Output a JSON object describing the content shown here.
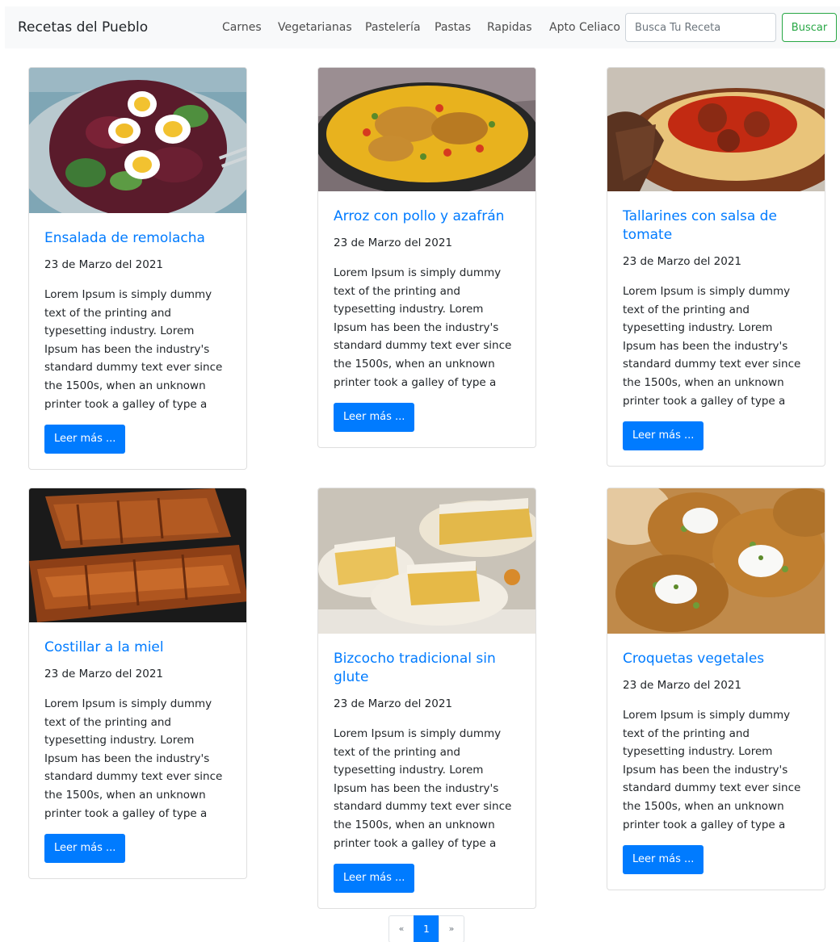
{
  "navbar": {
    "brand": "Recetas del Pueblo",
    "links": [
      "Carnes",
      "Vegetarianas",
      "Pastelería",
      "Pastas",
      "Rapidas",
      "Apto Celiaco"
    ],
    "search_placeholder": "Busca Tu Receta",
    "search_button": "Buscar"
  },
  "recipes": [
    {
      "title": "Ensalada de remolacha",
      "date": "23 de Marzo del 2021",
      "text": "Lorem Ipsum is simply dummy text of the printing and typesetting industry. Lorem Ipsum has been the industry's standard dummy text ever since the 1500s, when an unknown printer took a galley of type a",
      "button": "Leer más ..."
    },
    {
      "title": "Arroz con pollo y azafrán",
      "date": "23 de Marzo del 2021",
      "text": "Lorem Ipsum is simply dummy text of the printing and typesetting industry. Lorem Ipsum has been the industry's standard dummy text ever since the 1500s, when an unknown printer took a galley of type a",
      "button": "Leer más ..."
    },
    {
      "title": "Tallarines con salsa de tomate",
      "date": "23 de Marzo del 2021",
      "text": "Lorem Ipsum is simply dummy text of the printing and typesetting industry. Lorem Ipsum has been the industry's standard dummy text ever since the 1500s, when an unknown printer took a galley of type a",
      "button": "Leer más ..."
    },
    {
      "title": "Costillar a la miel",
      "date": "23 de Marzo del 2021",
      "text": "Lorem Ipsum is simply dummy text of the printing and typesetting industry. Lorem Ipsum has been the industry's standard dummy text ever since the 1500s, when an unknown printer took a galley of type a",
      "button": "Leer más ..."
    },
    {
      "title": "Bizcocho tradicional sin glute",
      "date": "23 de Marzo del 2021",
      "text": "Lorem Ipsum is simply dummy text of the printing and typesetting industry. Lorem Ipsum has been the industry's standard dummy text ever since the 1500s, when an unknown printer took a galley of type a",
      "button": "Leer más ..."
    },
    {
      "title": "Croquetas vegetales",
      "date": "23 de Marzo del 2021",
      "text": "Lorem Ipsum is simply dummy text of the printing and typesetting industry. Lorem Ipsum has been the industry's standard dummy text ever since the 1500s, when an unknown printer took a galley of type a",
      "button": "Leer más ..."
    }
  ],
  "pagination": {
    "prev": "«",
    "current": "1",
    "next": "»"
  },
  "colors": {
    "primary": "#007bff",
    "success": "#28a745",
    "navbar_bg": "#f8f9fa"
  }
}
